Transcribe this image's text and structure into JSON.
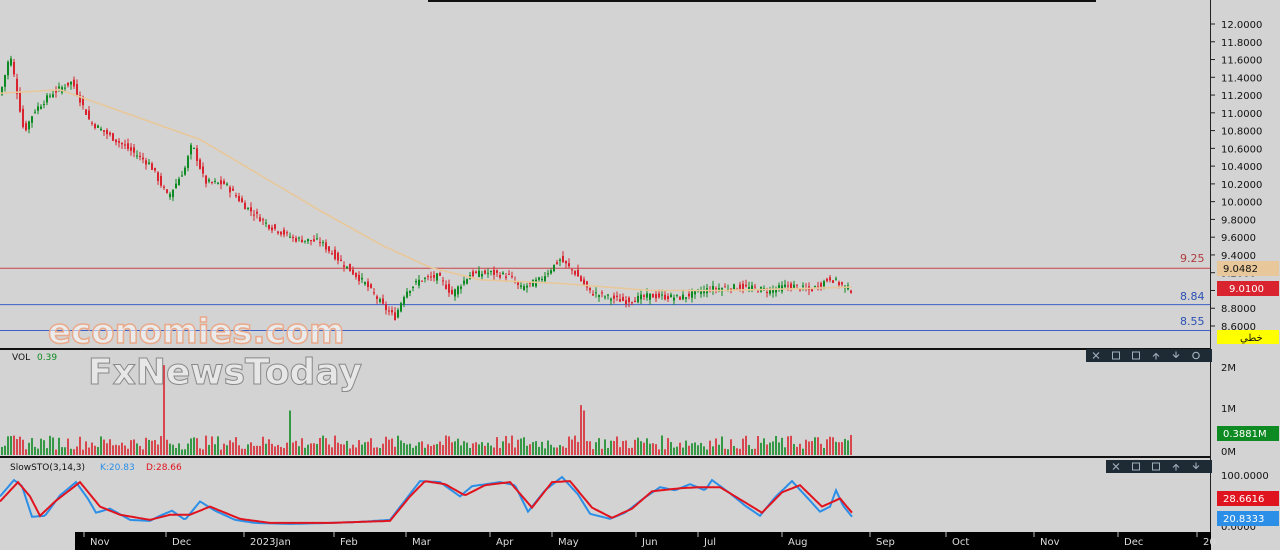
{
  "watermark": {
    "line1": "economies.com",
    "line2": "FxNewsToday"
  },
  "colors": {
    "background": "#d3d3d3",
    "up_candle": "#0e8a22",
    "down_candle": "#d9232e",
    "ma_line": "#e8c89a",
    "resistance_line": "#c9454b",
    "support_line": "#3b5fc7",
    "stoch_k": "#2b8fe8",
    "stoch_d": "#e0141e"
  },
  "price_axis_ticks": [
    "12.0000",
    "11.8000",
    "11.6000",
    "11.4000",
    "11.2000",
    "11.0000",
    "10.8000",
    "10.6000",
    "10.4000",
    "10.2000",
    "10.0000",
    "9.8000",
    "9.6000",
    "9.4000",
    "9.2000",
    "9.0000",
    "8.8000",
    "8.6000"
  ],
  "levels": [
    {
      "label": "9.25",
      "value": 9.25,
      "kind": "resistance"
    },
    {
      "label": "8.84",
      "value": 8.84,
      "kind": "support"
    },
    {
      "label": "8.55",
      "value": 8.55,
      "kind": "support"
    }
  ],
  "price_badges": {
    "ma": "9.0482",
    "last": "9.0100",
    "tool": "خطي"
  },
  "volume_panel": {
    "label": "VOL",
    "value": "0.39",
    "axis": [
      "2M",
      "1M",
      "0M"
    ],
    "badge": "0.3881M"
  },
  "stoch_panel": {
    "label": "SlowSTO(3,14,3)",
    "k_label": "K:20.83",
    "d_label": "D:28.66",
    "axis": [
      "100.0000",
      "0.0000"
    ],
    "k_badge": "20.8333",
    "d_badge": "28.6616"
  },
  "panel_toolbar_icons": [
    "close-icon",
    "minimize-icon",
    "maximize-icon",
    "move-up-icon",
    "move-down-icon",
    "settings-icon",
    "more-icon"
  ],
  "x_labels": [
    "Nov",
    "Dec",
    "2023Jan",
    "Feb",
    "Mar",
    "Apr",
    "May",
    "Jun",
    "Jul",
    "Aug",
    "Sep",
    "Oct",
    "Nov",
    "Dec",
    "20"
  ],
  "chart_data": {
    "type": "candlestick",
    "title": "",
    "price_range": [
      8.48,
      12.1
    ],
    "volume_range_millions": [
      0,
      2.4
    ],
    "stoch_range": [
      0,
      100
    ],
    "price_keypoints": [
      [
        0,
        11.2
      ],
      [
        10,
        11.66
      ],
      [
        16,
        11.3
      ],
      [
        24,
        10.78
      ],
      [
        34,
        11.02
      ],
      [
        52,
        11.22
      ],
      [
        72,
        11.35
      ],
      [
        90,
        10.9
      ],
      [
        105,
        10.78
      ],
      [
        125,
        10.62
      ],
      [
        150,
        10.42
      ],
      [
        168,
        10.05
      ],
      [
        185,
        10.38
      ],
      [
        192,
        10.65
      ],
      [
        205,
        10.22
      ],
      [
        225,
        10.2
      ],
      [
        245,
        9.95
      ],
      [
        270,
        9.72
      ],
      [
        295,
        9.58
      ],
      [
        320,
        9.55
      ],
      [
        345,
        9.28
      ],
      [
        365,
        9.08
      ],
      [
        385,
        8.8
      ],
      [
        395,
        8.7
      ],
      [
        405,
        8.98
      ],
      [
        420,
        9.12
      ],
      [
        438,
        9.16
      ],
      [
        452,
        8.96
      ],
      [
        470,
        9.18
      ],
      [
        490,
        9.2
      ],
      [
        510,
        9.16
      ],
      [
        520,
        9.02
      ],
      [
        540,
        9.12
      ],
      [
        560,
        9.35
      ],
      [
        575,
        9.2
      ],
      [
        590,
        8.98
      ],
      [
        610,
        8.92
      ],
      [
        625,
        8.88
      ],
      [
        650,
        8.94
      ],
      [
        680,
        8.92
      ],
      [
        710,
        9.02
      ],
      [
        740,
        9.04
      ],
      [
        770,
        9.0
      ],
      [
        790,
        9.06
      ],
      [
        810,
        9.0
      ],
      [
        830,
        9.14
      ],
      [
        845,
        9.04
      ],
      [
        852,
        9.0
      ]
    ],
    "ma_keypoints": [
      [
        0,
        11.22
      ],
      [
        60,
        11.26
      ],
      [
        120,
        11.02
      ],
      [
        200,
        10.7
      ],
      [
        260,
        10.3
      ],
      [
        320,
        9.9
      ],
      [
        380,
        9.52
      ],
      [
        430,
        9.26
      ],
      [
        480,
        9.12
      ],
      [
        560,
        9.08
      ],
      [
        650,
        9.0
      ],
      [
        720,
        9.0
      ],
      [
        800,
        9.02
      ],
      [
        852,
        9.04
      ]
    ],
    "volume_spikes_millions": [
      [
        165,
        2.02
      ],
      [
        290,
        1.0
      ],
      [
        580,
        1.12
      ],
      [
        585,
        1.0
      ],
      [
        850,
        0.45
      ]
    ],
    "stoch_k_keypoints": [
      [
        0,
        60
      ],
      [
        14,
        92
      ],
      [
        22,
        80
      ],
      [
        32,
        20
      ],
      [
        45,
        22
      ],
      [
        60,
        62
      ],
      [
        76,
        88
      ],
      [
        88,
        55
      ],
      [
        96,
        28
      ],
      [
        110,
        36
      ],
      [
        130,
        14
      ],
      [
        150,
        12
      ],
      [
        160,
        22
      ],
      [
        172,
        32
      ],
      [
        185,
        14
      ],
      [
        200,
        50
      ],
      [
        215,
        32
      ],
      [
        235,
        14
      ],
      [
        255,
        8
      ],
      [
        290,
        6
      ],
      [
        330,
        8
      ],
      [
        360,
        10
      ],
      [
        390,
        14
      ],
      [
        405,
        52
      ],
      [
        420,
        90
      ],
      [
        440,
        88
      ],
      [
        460,
        60
      ],
      [
        472,
        80
      ],
      [
        500,
        88
      ],
      [
        515,
        82
      ],
      [
        528,
        30
      ],
      [
        545,
        72
      ],
      [
        562,
        98
      ],
      [
        578,
        64
      ],
      [
        590,
        26
      ],
      [
        610,
        16
      ],
      [
        625,
        28
      ],
      [
        645,
        58
      ],
      [
        660,
        78
      ],
      [
        675,
        72
      ],
      [
        690,
        84
      ],
      [
        705,
        72
      ],
      [
        712,
        92
      ],
      [
        730,
        66
      ],
      [
        745,
        42
      ],
      [
        760,
        22
      ],
      [
        775,
        58
      ],
      [
        792,
        90
      ],
      [
        808,
        56
      ],
      [
        820,
        30
      ],
      [
        830,
        40
      ],
      [
        836,
        72
      ],
      [
        843,
        42
      ],
      [
        852,
        20
      ]
    ],
    "stoch_d_keypoints": [
      [
        0,
        50
      ],
      [
        18,
        88
      ],
      [
        30,
        60
      ],
      [
        40,
        22
      ],
      [
        55,
        50
      ],
      [
        80,
        88
      ],
      [
        100,
        40
      ],
      [
        120,
        24
      ],
      [
        150,
        14
      ],
      [
        170,
        24
      ],
      [
        190,
        24
      ],
      [
        210,
        40
      ],
      [
        240,
        16
      ],
      [
        270,
        8
      ],
      [
        330,
        8
      ],
      [
        390,
        12
      ],
      [
        410,
        60
      ],
      [
        425,
        90
      ],
      [
        445,
        84
      ],
      [
        465,
        62
      ],
      [
        485,
        82
      ],
      [
        510,
        88
      ],
      [
        532,
        38
      ],
      [
        552,
        88
      ],
      [
        570,
        90
      ],
      [
        592,
        38
      ],
      [
        612,
        18
      ],
      [
        632,
        36
      ],
      [
        652,
        70
      ],
      [
        680,
        76
      ],
      [
        700,
        78
      ],
      [
        720,
        78
      ],
      [
        742,
        52
      ],
      [
        762,
        28
      ],
      [
        782,
        68
      ],
      [
        800,
        82
      ],
      [
        822,
        40
      ],
      [
        840,
        56
      ],
      [
        852,
        28
      ]
    ]
  }
}
